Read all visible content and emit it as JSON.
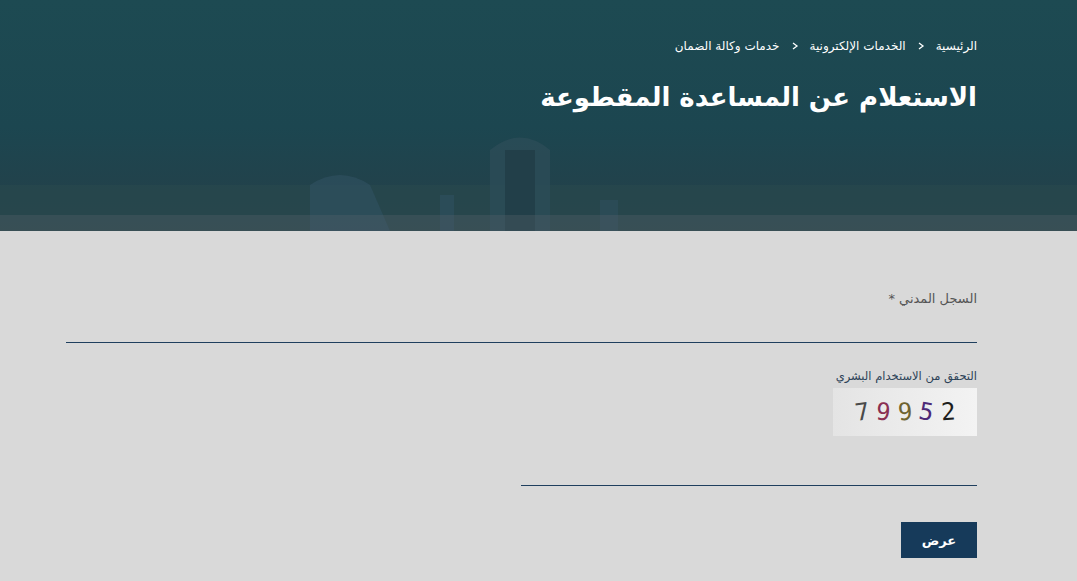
{
  "breadcrumb": [
    {
      "label": "الرئيسية"
    },
    {
      "label": "الخدمات الإلكترونية"
    },
    {
      "label": "خدمات وكالة الضمان"
    }
  ],
  "title": "الاستعلام عن المساعدة المقطوعة",
  "form": {
    "civil_record": {
      "label": "السجل المدني",
      "required_marker": "*",
      "value": ""
    },
    "captcha": {
      "label": "التحقق من الاستخدام البشري",
      "chars": [
        {
          "char": "7",
          "color": "#4a4a4a"
        },
        {
          "char": "9",
          "color": "#8a2f52"
        },
        {
          "char": "9",
          "color": "#6e6330"
        },
        {
          "char": "5",
          "color": "#4d2a78"
        },
        {
          "char": "2",
          "color": "#1e1e1e"
        }
      ],
      "value": ""
    },
    "submit": "عرض"
  }
}
